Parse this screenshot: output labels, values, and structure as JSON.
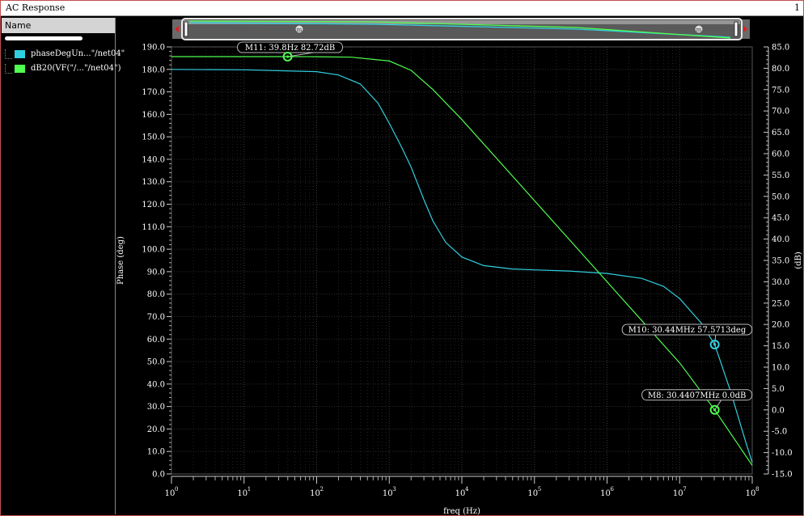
{
  "window": {
    "title": "AC Response",
    "index": "1"
  },
  "panel": {
    "header": "Name"
  },
  "legend": [
    {
      "label": "phaseDegUn...\"/net04\"",
      "color": "#30d0e0"
    },
    {
      "label": "dB20(VF(\"/...\"/net04\")",
      "color": "#50ff50"
    }
  ],
  "chart_data": {
    "type": "line",
    "xlabel": "freq (Hz)",
    "ylabel_left": "Phase (deg)",
    "ylabel_right": "(dB)",
    "x_scale": "log",
    "xlim": [
      1,
      100000000
    ],
    "ylim_left": [
      0,
      190
    ],
    "ylim_right": [
      -15,
      85
    ],
    "grid": true,
    "x_ticks": [
      {
        "base": "10",
        "exp": "0"
      },
      {
        "base": "10",
        "exp": "1"
      },
      {
        "base": "10",
        "exp": "2"
      },
      {
        "base": "10",
        "exp": "3"
      },
      {
        "base": "10",
        "exp": "4"
      },
      {
        "base": "10",
        "exp": "5"
      },
      {
        "base": "10",
        "exp": "6"
      },
      {
        "base": "10",
        "exp": "7"
      },
      {
        "base": "10",
        "exp": "8"
      }
    ],
    "y_ticks_left": [
      "0.0",
      "10.0",
      "20.0",
      "30.0",
      "40.0",
      "50.0",
      "60.0",
      "70.0",
      "80.0",
      "90.0",
      "100.0",
      "110.0",
      "120.0",
      "130.0",
      "140.0",
      "150.0",
      "160.0",
      "170.0",
      "180.0",
      "190.0"
    ],
    "y_ticks_right": [
      "-15.0",
      "-10.0",
      "-5.0",
      "0.0",
      "5.0",
      "10.0",
      "15.0",
      "20.0",
      "25.0",
      "30.0",
      "35.0",
      "40.0",
      "45.0",
      "50.0",
      "55.0",
      "60.0",
      "65.0",
      "70.0",
      "75.0",
      "80.0",
      "85.0"
    ],
    "series": [
      {
        "name": "phaseDegUn...\"/net04\"",
        "axis": "left",
        "color": "#30d0e0",
        "x": [
          1,
          10,
          100,
          200,
          400,
          700,
          1000,
          1500,
          2000,
          3000,
          4000,
          6000,
          10000,
          20000,
          50000,
          100000,
          300000,
          1000000,
          3000000,
          6000000,
          10000000,
          20000000,
          30440000,
          50000000,
          80000000,
          100000000
        ],
        "y": [
          180.0,
          179.8,
          179.0,
          177.5,
          173.5,
          165.0,
          156.0,
          145.0,
          136.5,
          122.0,
          112.5,
          103.0,
          96.5,
          92.7,
          91.2,
          90.8,
          90.3,
          89.2,
          87.0,
          83.5,
          78.0,
          67.0,
          57.57,
          37.0,
          15.0,
          5.0
        ]
      },
      {
        "name": "dB20(VF(\"/...\"/net04\")",
        "axis": "right",
        "color": "#50ff50",
        "x": [
          1,
          10,
          39.8,
          100,
          300,
          1000,
          2000,
          4000,
          10000,
          100000,
          1000000,
          10000000,
          30440000,
          100000000
        ],
        "y": [
          82.72,
          82.72,
          82.72,
          82.7,
          82.6,
          81.7,
          79.5,
          75.0,
          68.0,
          49.0,
          30.0,
          11.0,
          0.0,
          -13.0
        ]
      }
    ],
    "markers": [
      {
        "label": "M11: 39.8Hz 82.72dB",
        "x": 39.8,
        "y": 82.72,
        "axis": "right",
        "color": "#50ff50"
      },
      {
        "label": "M10: 30.44MHz 57.5713deg",
        "x": 30440000,
        "y": 57.5713,
        "axis": "left",
        "color": "#30d0e0"
      },
      {
        "label": "M8: 30.4407MHz 0.0dB",
        "x": 30440700,
        "y": 0.0,
        "axis": "right",
        "color": "#50ff50"
      }
    ]
  }
}
